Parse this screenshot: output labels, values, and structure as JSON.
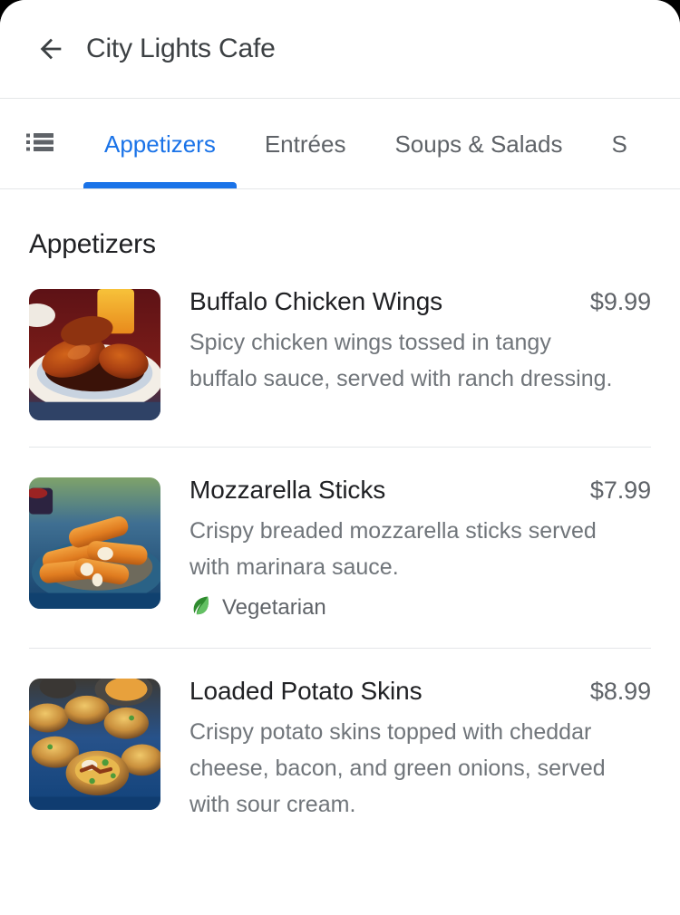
{
  "app": {
    "title": "City Lights Cafe",
    "back_icon": "arrow-back-icon",
    "accent_color": "#1a73e8",
    "title_color": "#3c4043"
  },
  "tabs": {
    "list_icon": "list-view-icon",
    "items": [
      {
        "label": "Appetizers",
        "active": true
      },
      {
        "label": "Entrées",
        "active": false
      },
      {
        "label": "Soups & Salads",
        "active": false
      },
      {
        "label": "S",
        "active": false
      }
    ]
  },
  "section": {
    "title": "Appetizers"
  },
  "menu_items": [
    {
      "name": "Buffalo Chicken Wings",
      "price": "$9.99",
      "description": "Spicy chicken wings tossed in tangy buffalo sauce, served with ranch dressing.",
      "image_alt": "buffalo-chicken-wings-photo",
      "badges": []
    },
    {
      "name": "Mozzarella Sticks",
      "price": "$7.99",
      "description": "Crispy breaded mozzarella sticks served with marinara sauce.",
      "image_alt": "mozzarella-sticks-photo",
      "badges": [
        {
          "label": "Vegetarian",
          "icon": "leaf-icon",
          "color": "#3a9a3a"
        }
      ]
    },
    {
      "name": "Loaded Potato Skins",
      "price": "$8.99",
      "description": "Crispy potato skins topped with cheddar cheese, bacon, and green onions, served with sour cream.",
      "image_alt": "loaded-potato-skins-photo",
      "badges": []
    }
  ]
}
